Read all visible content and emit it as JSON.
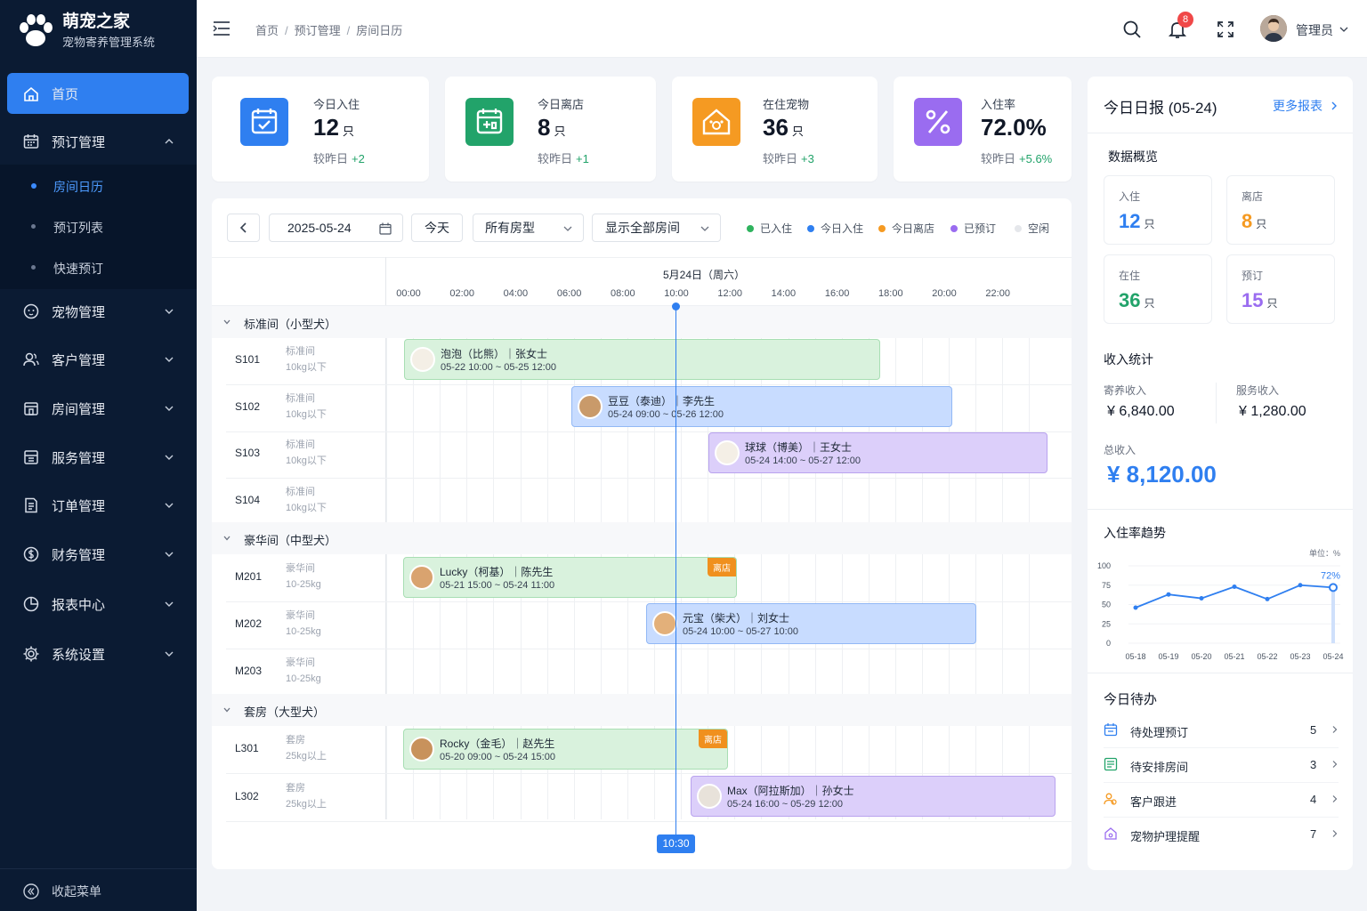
{
  "app": {
    "title": "萌宠之家",
    "subtitle": "宠物寄养管理系统"
  },
  "sidebar": {
    "items": [
      {
        "label": "首页",
        "icon": "home-icon"
      },
      {
        "label": "预订管理",
        "icon": "calendar-icon"
      },
      {
        "label": "宠物管理",
        "icon": "pet-icon"
      },
      {
        "label": "客户管理",
        "icon": "users-icon"
      },
      {
        "label": "房间管理",
        "icon": "room-icon"
      },
      {
        "label": "服务管理",
        "icon": "service-icon"
      },
      {
        "label": "订单管理",
        "icon": "order-icon"
      },
      {
        "label": "财务管理",
        "icon": "finance-icon"
      },
      {
        "label": "报表中心",
        "icon": "report-icon"
      },
      {
        "label": "系统设置",
        "icon": "gear-icon"
      }
    ],
    "sub_items": [
      {
        "label": "房间日历"
      },
      {
        "label": "预订列表"
      },
      {
        "label": "快速预订"
      }
    ],
    "collapse_label": "收起菜单"
  },
  "header": {
    "breadcrumb": [
      "首页",
      "预订管理",
      "房间日历"
    ],
    "notification_count": "8",
    "user_name": "管理员"
  },
  "stats": [
    {
      "title": "今日入住",
      "value": "12",
      "unit": "只",
      "compare": "较昨日",
      "delta": "+2",
      "color": "#2f7ff0"
    },
    {
      "title": "今日离店",
      "value": "8",
      "unit": "只",
      "compare": "较昨日",
      "delta": "+1",
      "color": "#22a36a"
    },
    {
      "title": "在住宠物",
      "value": "36",
      "unit": "只",
      "compare": "较昨日",
      "delta": "+3",
      "color": "#f59a22"
    },
    {
      "title": "入住率",
      "value": "72.0%",
      "unit": "",
      "compare": "较昨日",
      "delta": "+5.6%",
      "color": "#9a6cf0"
    }
  ],
  "calendar": {
    "date": "2025-05-24",
    "today_label": "今天",
    "room_type_select": "所有房型",
    "room_display_select": "显示全部房间",
    "legend": [
      {
        "label": "已入住",
        "color": "#2fb35e"
      },
      {
        "label": "今日入住",
        "color": "#2f7ff0"
      },
      {
        "label": "今日离店",
        "color": "#f59a22"
      },
      {
        "label": "已预订",
        "color": "#9a6cf0"
      },
      {
        "label": "空闲",
        "color": "#e5e7eb"
      }
    ],
    "day_title": "5月24日（周六）",
    "hours": [
      "00:00",
      "02:00",
      "04:00",
      "06:00",
      "08:00",
      "10:00",
      "12:00",
      "14:00",
      "16:00",
      "18:00",
      "20:00",
      "22:00"
    ],
    "current_time": "10:30",
    "groups": [
      {
        "label": "标准间（小型犬）",
        "rooms": [
          {
            "no": "S101",
            "type": "标准间",
            "size": "10kg以下"
          },
          {
            "no": "S102",
            "type": "标准间",
            "size": "10kg以下"
          },
          {
            "no": "S103",
            "type": "标准间",
            "size": "10kg以下"
          },
          {
            "no": "S104",
            "type": "标准间",
            "size": "10kg以下"
          }
        ]
      },
      {
        "label": "豪华间（中型犬）",
        "rooms": [
          {
            "no": "M201",
            "type": "豪华间",
            "size": "10-25kg"
          },
          {
            "no": "M202",
            "type": "豪华间",
            "size": "10-25kg"
          },
          {
            "no": "M203",
            "type": "豪华间",
            "size": "10-25kg"
          }
        ]
      },
      {
        "label": "套房（大型犬）",
        "rooms": [
          {
            "no": "L301",
            "type": "套房",
            "size": "25kg以上"
          },
          {
            "no": "L302",
            "type": "套房",
            "size": "25kg以上"
          }
        ]
      }
    ],
    "bookings": [
      {
        "name": "泡泡（比熊）｜张女士",
        "dates": "05-22 10:00 ~ 05-25 12:00",
        "status": "已入住",
        "tag": ""
      },
      {
        "name": "豆豆（泰迪）｜李先生",
        "dates": "05-24 09:00 ~ 05-26 12:00",
        "status": "今日入住",
        "tag": ""
      },
      {
        "name": "球球（博美）｜王女士",
        "dates": "05-24 14:00 ~ 05-27 12:00",
        "status": "已预订",
        "tag": ""
      },
      {
        "name": "Lucky（柯基）｜陈先生",
        "dates": "05-21 15:00 ~ 05-24 11:00",
        "status": "已入住",
        "tag": "离店"
      },
      {
        "name": "元宝（柴犬）｜刘女士",
        "dates": "05-24 10:00 ~ 05-27 10:00",
        "status": "今日入住",
        "tag": ""
      },
      {
        "name": "Rocky（金毛）｜赵先生",
        "dates": "05-20 09:00 ~ 05-24 15:00",
        "status": "已入住",
        "tag": "离店"
      },
      {
        "name": "Max（阿拉斯加）｜孙女士",
        "dates": "05-24 16:00 ~ 05-29 12:00",
        "status": "已预订",
        "tag": ""
      }
    ]
  },
  "report": {
    "title": "今日日报 (05-24)",
    "more": "更多报表",
    "overview_title": "数据概览",
    "overview": [
      {
        "label": "入住",
        "value": "12",
        "unit": "只",
        "color": "#2f7ff0"
      },
      {
        "label": "离店",
        "value": "8",
        "unit": "只",
        "color": "#f59a22"
      },
      {
        "label": "在住",
        "value": "36",
        "unit": "只",
        "color": "#22a36a"
      },
      {
        "label": "预订",
        "value": "15",
        "unit": "只",
        "color": "#9a6cf0"
      }
    ],
    "income_title": "收入统计",
    "boarding_income_label": "寄养收入",
    "boarding_income": "¥ 6,840.00",
    "service_income_label": "服务收入",
    "service_income": "¥ 1,280.00",
    "total_label": "总收入",
    "total": "¥ 8,120.00",
    "trend_title": "入住率趋势",
    "todo_title": "今日待办",
    "todos": [
      {
        "label": "待处理预订",
        "count": "5",
        "icon": "calendar-icon"
      },
      {
        "label": "待安排房间",
        "count": "3",
        "icon": "room-icon"
      },
      {
        "label": "客户跟进",
        "count": "4",
        "icon": "users-icon"
      },
      {
        "label": "宠物护理提醒",
        "count": "7",
        "icon": "home-icon"
      }
    ]
  },
  "chart_data": {
    "type": "line",
    "title": "入住率趋势",
    "unit_label": "单位：%",
    "x": [
      "05-18",
      "05-19",
      "05-20",
      "05-21",
      "05-22",
      "05-23",
      "05-24"
    ],
    "values": [
      46,
      63,
      58,
      73,
      57,
      75,
      72
    ],
    "ylim": [
      0,
      100
    ],
    "yticks": [
      0,
      25,
      50,
      75,
      100
    ],
    "last_label": "72%",
    "color": "#2f7ff0"
  }
}
